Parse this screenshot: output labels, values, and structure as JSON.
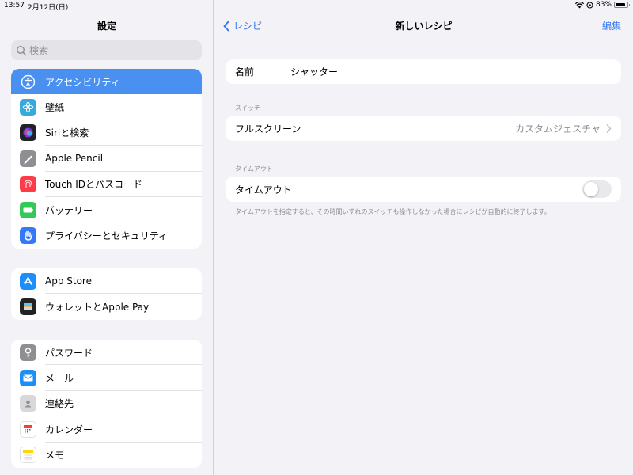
{
  "status": {
    "time": "13:57",
    "date": "2月12日(日)",
    "battery": "83%"
  },
  "sidebar": {
    "title": "設定",
    "search_placeholder": "検索",
    "groups": [
      {
        "items": [
          {
            "label": "アクセシビリティ",
            "icon": "accessibility-icon",
            "color": "#3478f6",
            "active": true
          },
          {
            "label": "壁紙",
            "icon": "wallpaper-icon",
            "color": "#37aadc"
          },
          {
            "label": "Siriと検索",
            "icon": "siri-icon",
            "color": "#222222"
          },
          {
            "label": "Apple Pencil",
            "icon": "pencil-icon",
            "color": "#8e8e93"
          },
          {
            "label": "Touch IDとパスコード",
            "icon": "fingerprint-icon",
            "color": "#ff3b48"
          },
          {
            "label": "バッテリー",
            "icon": "battery-icon",
            "color": "#34c759"
          },
          {
            "label": "プライバシーとセキュリティ",
            "icon": "hand-icon",
            "color": "#3478f6"
          }
        ]
      },
      {
        "items": [
          {
            "label": "App Store",
            "icon": "app-store-icon",
            "color": "#1c8ef9"
          },
          {
            "label": "ウォレットとApple Pay",
            "icon": "wallet-icon",
            "color": "#222222"
          }
        ]
      },
      {
        "items": [
          {
            "label": "パスワード",
            "icon": "key-icon",
            "color": "#8e8e93"
          },
          {
            "label": "メール",
            "icon": "mail-icon",
            "color": "#1c8ef9"
          },
          {
            "label": "連絡先",
            "icon": "contacts-icon",
            "color": "#b0b0b5"
          },
          {
            "label": "カレンダー",
            "icon": "calendar-icon",
            "color": "#ffffff"
          },
          {
            "label": "メモ",
            "icon": "notes-icon",
            "color": "#ffffff"
          }
        ]
      }
    ]
  },
  "main": {
    "back_label": "レシピ",
    "title": "新しいレシピ",
    "edit_label": "編集",
    "name_label": "名前",
    "name_value": "シャッター",
    "switch_header": "スイッチ",
    "switch_label": "フルスクリーン",
    "switch_value": "カスタムジェスチャ",
    "timeout_header": "タイムアウト",
    "timeout_label": "タイムアウト",
    "timeout_on": false,
    "timeout_note": "タイムアウトを指定すると、その時間いずれのスイッチも操作しなかった場合にレシピが自動的に終了します。"
  },
  "colors": {
    "accent": "#3478f6",
    "selected_row": "#4a90f0"
  }
}
